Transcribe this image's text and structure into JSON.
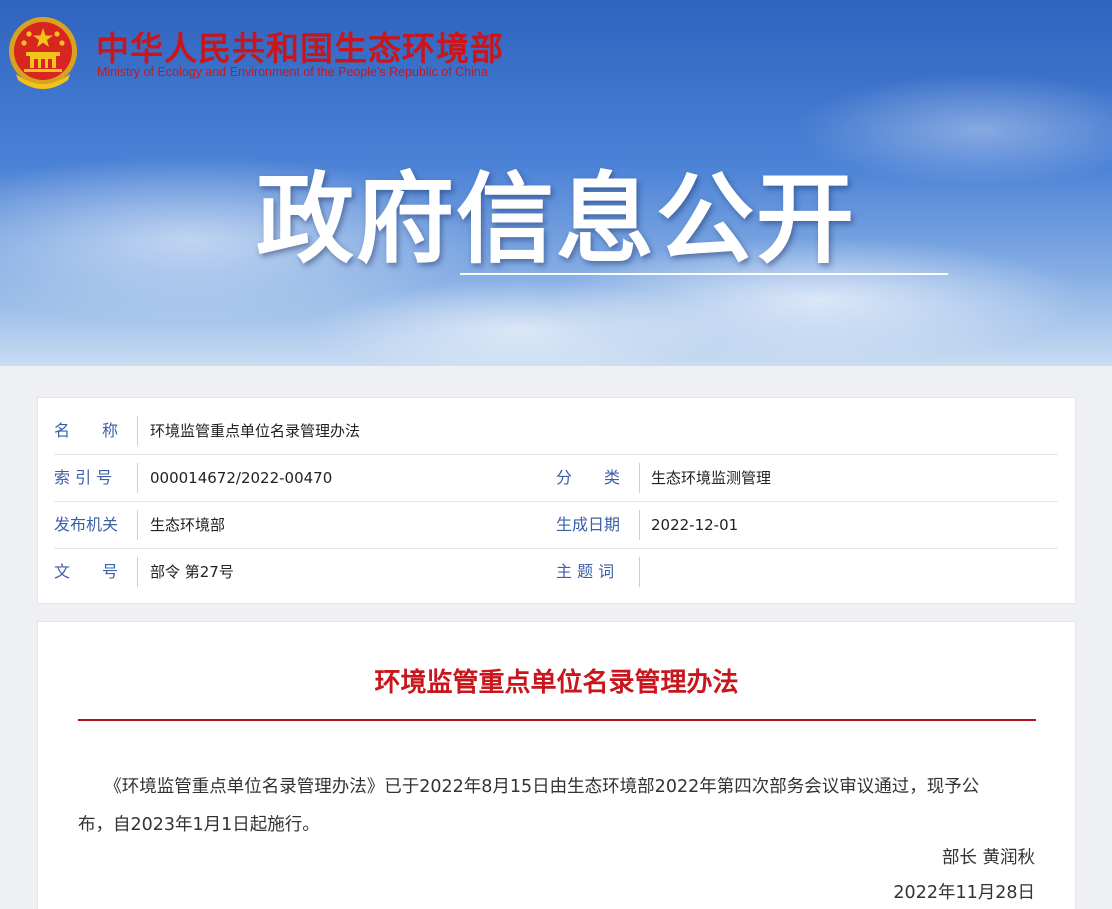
{
  "header": {
    "site_name_cn": "中华人民共和国生态环境部",
    "site_name_en": "Ministry of Ecology and Environment of the People's Republic of China",
    "banner_title": "政府信息公开"
  },
  "meta": {
    "name_label": "名　　称",
    "name_value": "环境监管重点单位名录管理办法",
    "index_label": "索 引 号",
    "index_value": "000014672/2022-00470",
    "category_label": "分　　类",
    "category_value": "生态环境监测管理",
    "issuer_label": "发布机关",
    "issuer_value": "生态环境部",
    "date_label": "生成日期",
    "date_value": "2022-12-01",
    "docno_label": "文　　号",
    "docno_value": "部令 第27号",
    "keywords_label": "主 题 词",
    "keywords_value": ""
  },
  "article": {
    "title": "环境监管重点单位名录管理办法",
    "paragraph": "　　《环境监管重点单位名录管理办法》已于2022年8月15日由生态环境部2022年第四次部务会议审议通过，现予公布，自2023年1月1日起施行。",
    "signer": "部长 黄润秋",
    "sign_date": "2022年11月28日"
  },
  "colors": {
    "brand_red": "#c8161d",
    "label_blue": "#3d5fa8",
    "banner_blue": "#2f63bf"
  }
}
